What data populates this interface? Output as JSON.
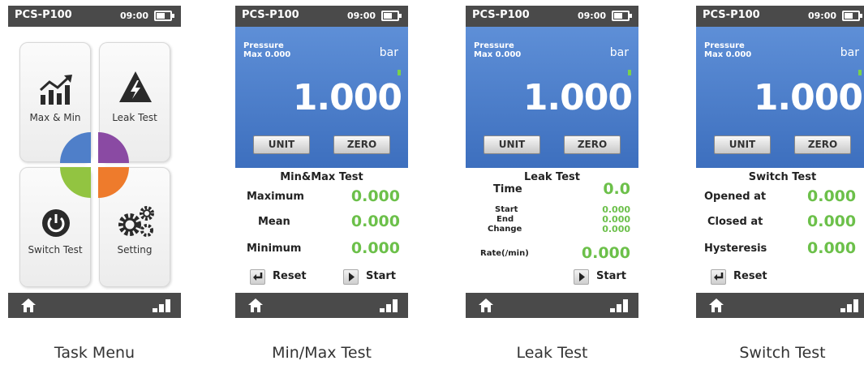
{
  "status": {
    "model": "PCS-P100",
    "time": "09:00"
  },
  "task_menu": {
    "caption": "Task Menu",
    "tiles": [
      {
        "label": "Max & Min",
        "icon": "chart-up-icon"
      },
      {
        "label": "Leak Test",
        "icon": "lightning-warning-icon"
      },
      {
        "label": "Switch Test",
        "icon": "power-icon"
      },
      {
        "label": "Setting",
        "icon": "gears-icon"
      }
    ],
    "center_colors": [
      "#4f7fc9",
      "#8a4aa3",
      "#92c441",
      "#ee7b2c"
    ]
  },
  "pressure_panel": {
    "label_line1": "Pressure",
    "label_line2": "Max 0.000",
    "unit": "bar",
    "value": "1.000",
    "unit_button": "UNIT",
    "zero_button": "ZERO"
  },
  "minmax": {
    "caption": "Min/Max Test",
    "title": "Min&Max Test",
    "rows": [
      {
        "label": "Maximum",
        "value": "0.000"
      },
      {
        "label": "Mean",
        "value": "0.000"
      },
      {
        "label": "Minimum",
        "value": "0.000"
      }
    ],
    "reset": "Reset",
    "start": "Start"
  },
  "leak": {
    "caption": "Leak Test",
    "title": "Leak Test",
    "time_label": "Time",
    "time_value": "0.0",
    "start_label": "Start",
    "start_value": "0.000",
    "end_label": "End",
    "end_value": "0.000",
    "change_label": "Change",
    "change_value": "0.000",
    "rate_label": "Rate(/min)",
    "rate_value": "0.000",
    "start": "Start"
  },
  "switch": {
    "caption": "Switch Test",
    "title": "Switch Test",
    "rows": [
      {
        "label": "Opened at",
        "value": "0.000"
      },
      {
        "label": "Closed at",
        "value": "0.000"
      },
      {
        "label": "Hysteresis",
        "value": "0.000"
      }
    ],
    "reset": "Reset"
  }
}
